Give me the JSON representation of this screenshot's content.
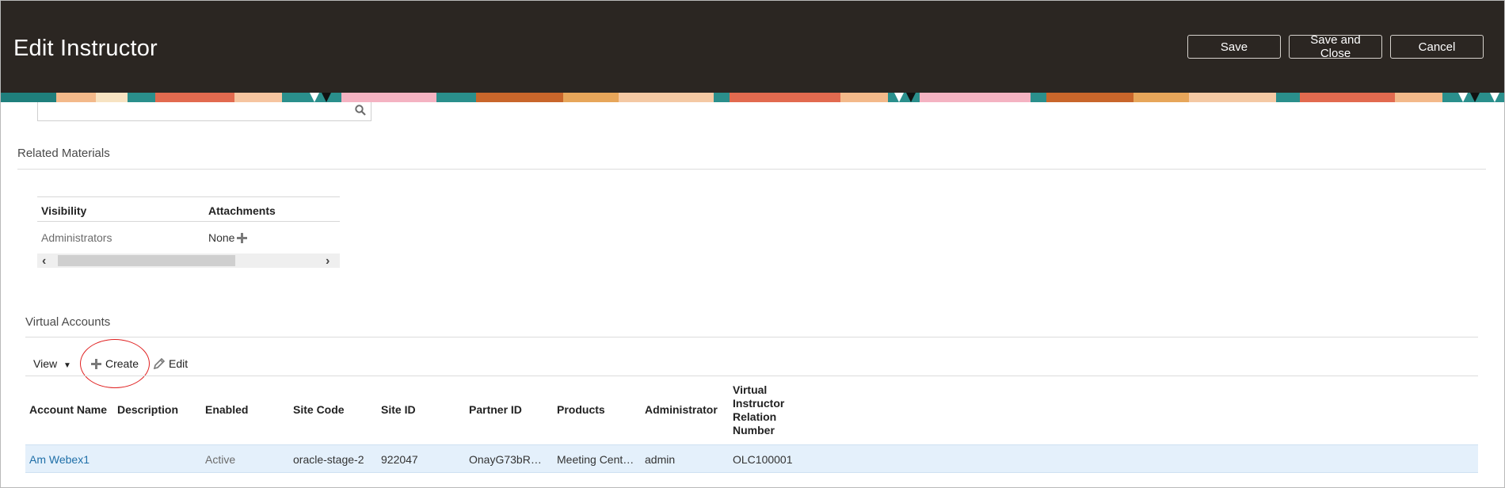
{
  "header": {
    "title": "Edit Instructor",
    "buttons": {
      "save": "Save",
      "save_close": "Save and Close",
      "cancel": "Cancel"
    },
    "bg_color": "#2b2622"
  },
  "related_materials": {
    "title": "Related Materials",
    "columns": [
      "Visibility",
      "Attachments"
    ],
    "rows": [
      {
        "visibility": "Administrators",
        "attachments": "None"
      }
    ]
  },
  "virtual_accounts": {
    "title": "Virtual Accounts",
    "toolbar": {
      "view": "View",
      "create": "Create",
      "edit": "Edit"
    },
    "columns": [
      "Account Name",
      "Description",
      "Enabled",
      "Site Code",
      "Site ID",
      "Partner ID",
      "Products",
      "Administrator",
      "Virtual Instructor Relation Number"
    ],
    "column_lines": [
      "Virtual",
      "Instructor",
      "Relation",
      "Number"
    ],
    "rows": [
      {
        "account_name": "Am Webex1",
        "description": "",
        "enabled": "Active",
        "site_code": "oracle-stage-2",
        "site_id": "922047",
        "partner_id": "OnayG73bR…",
        "products": "Meeting Cent…",
        "administrator": "admin",
        "relation_number": "OLC100001"
      }
    ],
    "selected_row_color": "#e4f0fb",
    "link_color": "#1f6fa8"
  },
  "annotation_color": "#e02020"
}
